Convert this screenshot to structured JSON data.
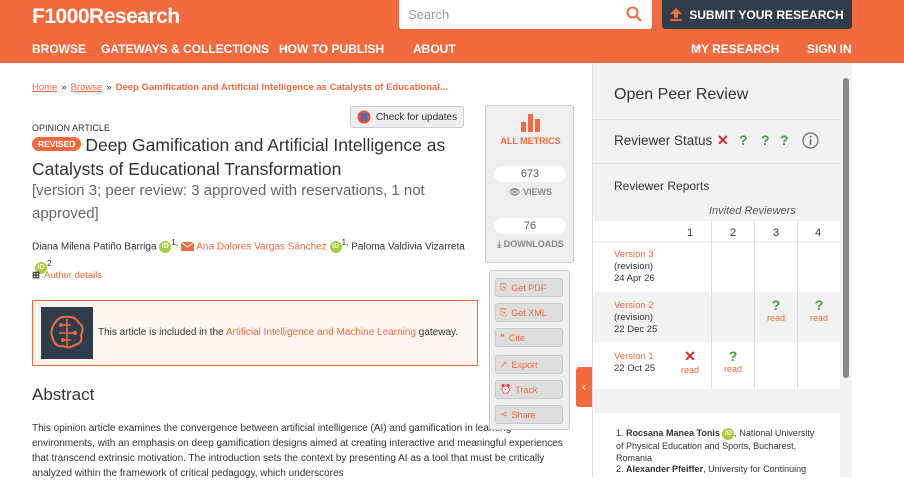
{
  "header": {
    "logo": "F1000Research",
    "search_placeholder": "Search",
    "submit": "SUBMIT YOUR RESEARCH"
  },
  "nav": {
    "browse": "BROWSE",
    "gateways": "GATEWAYS & COLLECTIONS",
    "how": "HOW TO PUBLISH",
    "about": "ABOUT",
    "myresearch": "MY RESEARCH",
    "signin": "SIGN IN"
  },
  "breadcrumb": {
    "home": "Home",
    "browse": "Browse",
    "current": "Deep Gamification and Artificial Intelligence as Catalysts of Educational..."
  },
  "article": {
    "check_updates": "Check for updates",
    "type": "OPINION ARTICLE",
    "badge": "REVISED",
    "title": "Deep Gamification and Artificial Intelligence as Catalysts of Educational Transformation",
    "version": "[version 3; peer review: 3 approved with reservations, 1 not approved]",
    "author1": "Diana Milena Patiño Barriga",
    "author1_sup": "1,",
    "author2": "Ana Dolores Vargas Sánchez",
    "author2_sup": "1,",
    "author3": "Paloma Valdivia Vizarreta",
    "author3_sup": "2",
    "author_details": "Author details",
    "gateway_prefix": "This article is included in the",
    "gateway_link": "Artificial Intelligence and Machine Learning",
    "gateway_suffix": "gateway.",
    "abstract_h": "Abstract",
    "abstract": "This opinion article examines the convergence between artificial intelligence (AI) and gamification in learning environments, with an emphasis on deep gamification designs aimed at creating interactive and meaningful experiences that transcend extrinsic motivation. The introduction sets the context by presenting AI as a tool that must be critically analyzed within the framework of critical pedagogy, which underscores"
  },
  "metrics": {
    "label": "ALL METRICS",
    "views": "673",
    "views_label": "VIEWS",
    "downloads": "76",
    "downloads_label": "DOWNLOADS"
  },
  "tools": {
    "pdf": "Get PDF",
    "xml": "Get XML",
    "cite": "Cite",
    "export": "Export",
    "track": "Track",
    "share": "Share"
  },
  "review": {
    "title": "Open Peer Review",
    "status_label": "Reviewer Status",
    "reports": "Reviewer Reports",
    "invited": "Invited Reviewers",
    "cols": [
      "1",
      "2",
      "3",
      "4"
    ],
    "v3": {
      "name": "Version 3",
      "sub": "(revision)",
      "date": "24 Apr 26"
    },
    "v2": {
      "name": "Version 2",
      "sub": "(revision)",
      "date": "22 Dec 25"
    },
    "v1": {
      "name": "Version 1",
      "date": "22 Oct 25"
    },
    "read": "read",
    "r1_num": "1.",
    "r1_name": "Rocsana Manea Tonis",
    "r1_aff": ", National University of Physical Education and Sports, Bucharest, Romania",
    "r2_num": "2.",
    "r2_name": "Alexander Pfeiffer",
    "r2_aff": ", University for Continuing"
  },
  "colors": {
    "brand": "#f26a3e",
    "dark": "#2f3d4a",
    "approved": "#3ea23e",
    "rejected": "#d9232e"
  }
}
